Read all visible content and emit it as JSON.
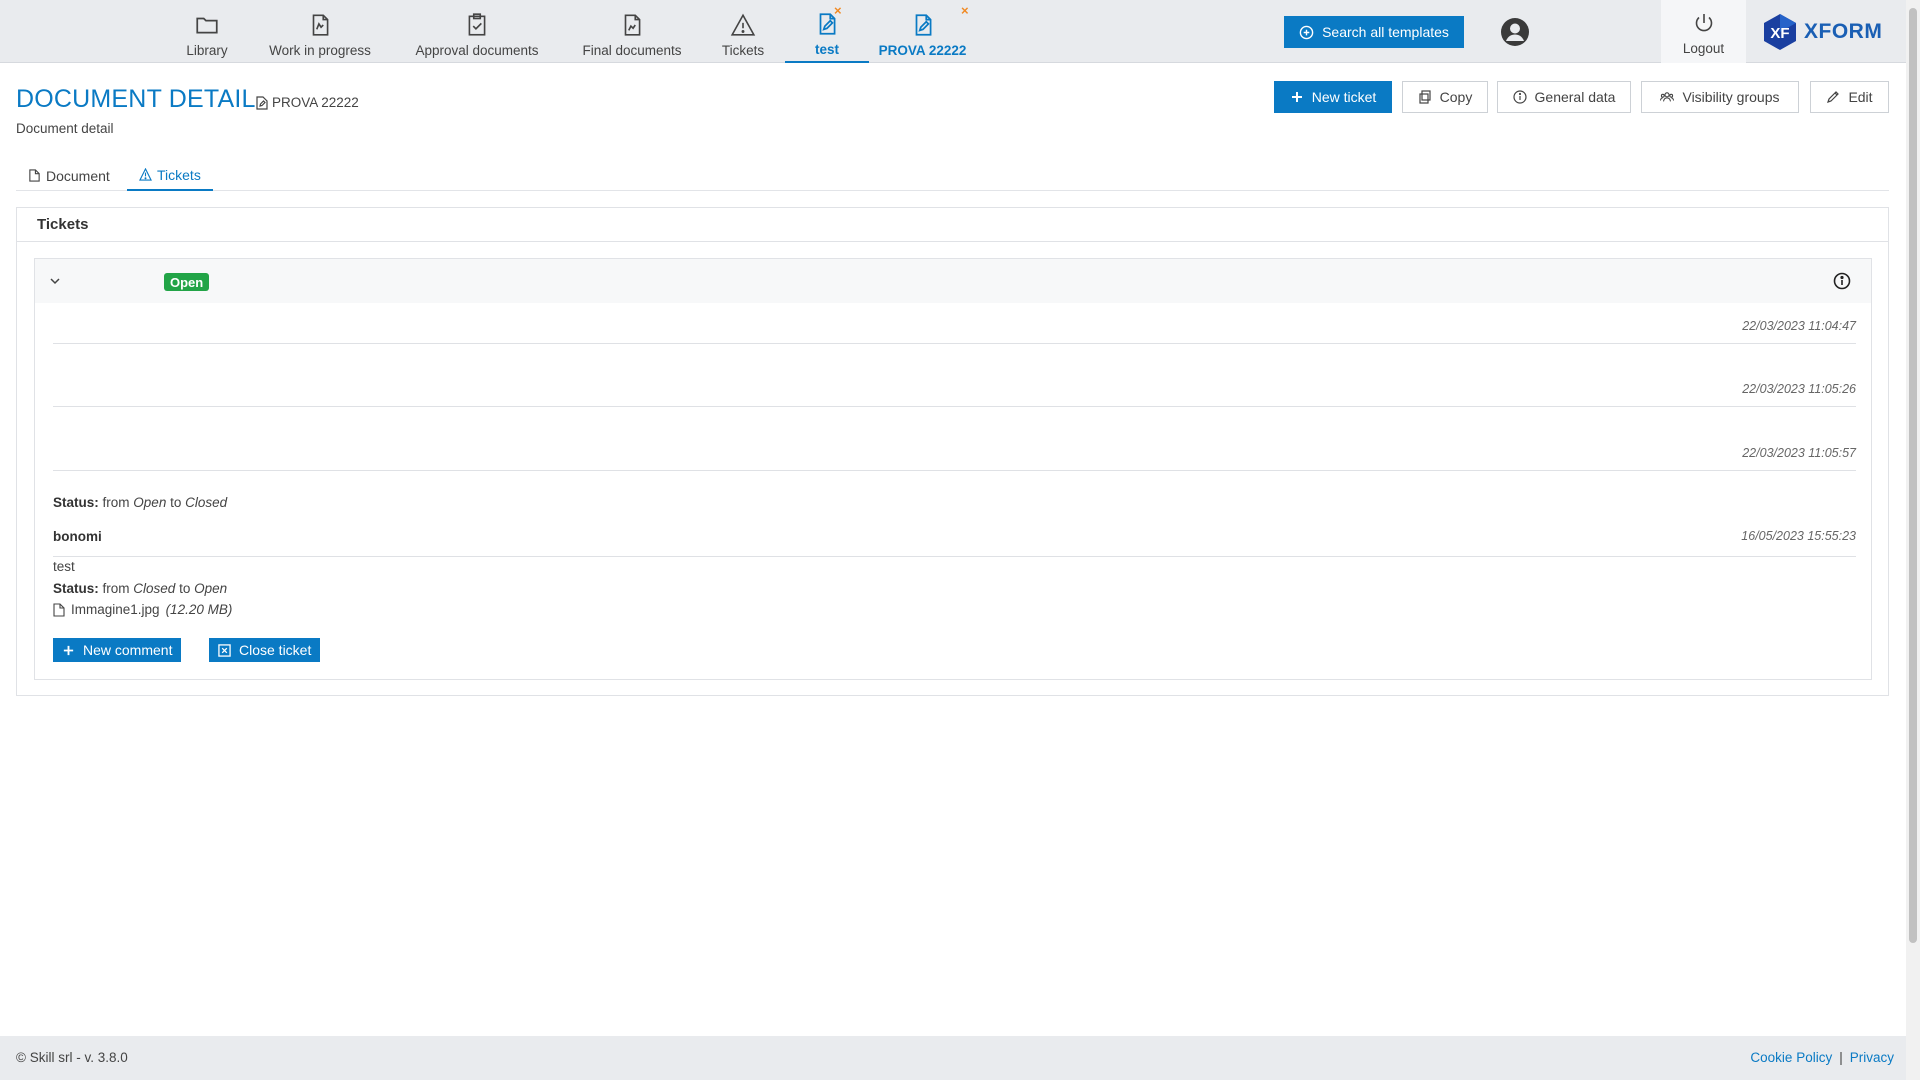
{
  "nav": {
    "items": [
      {
        "label": "Library",
        "icon": "folder-icon"
      },
      {
        "label": "Work in progress",
        "icon": "document-edit-icon"
      },
      {
        "label": "Approval documents",
        "icon": "clipboard-check-icon"
      },
      {
        "label": "Final documents",
        "icon": "document-chart-icon"
      },
      {
        "label": "Tickets",
        "icon": "warning-icon"
      },
      {
        "label": "test",
        "icon": "document-pen-icon",
        "active": true,
        "closable": true
      },
      {
        "label": "PROVA 22222",
        "icon": "document-pen-icon",
        "closable": true
      }
    ],
    "close_glyph": "×"
  },
  "search": {
    "label": "Search all templates"
  },
  "logout": {
    "label": "Logout"
  },
  "logo": {
    "mark": "XF",
    "word": "XFORM"
  },
  "header": {
    "title": "DOCUMENT DETAIL",
    "doc_ref": "PROVA 22222",
    "subtitle": "Document detail"
  },
  "actions": {
    "new_ticket": "New ticket",
    "copy": "Copy",
    "general_data": "General data",
    "visibility_groups": "Visibility groups",
    "edit": "Edit"
  },
  "tabs": [
    {
      "label": "Document"
    },
    {
      "label": "Tickets",
      "active": true
    }
  ],
  "tickets": {
    "title": "Tickets",
    "ticket": {
      "status": "Open",
      "entries": [
        {
          "timestamp": "22/03/2023 11:04:47"
        },
        {
          "timestamp": "22/03/2023 11:05:26"
        },
        {
          "timestamp": "22/03/2023 11:05:57"
        }
      ],
      "status_change_1": {
        "label": "Status:",
        "from_word": "from",
        "from": "Open",
        "to_word": "to",
        "to": "Closed"
      },
      "comment": {
        "author": "bonomi",
        "timestamp": "16/05/2023 15:55:23",
        "text": "test",
        "status_change": {
          "label": "Status:",
          "from_word": "from",
          "from": "Closed",
          "to_word": "to",
          "to": "Open"
        },
        "attachment": {
          "name": "Immagine1.jpg",
          "size": "(12.20 MB)"
        }
      },
      "buttons": {
        "new_comment": "New comment",
        "close_ticket": "Close ticket"
      }
    }
  },
  "footer": {
    "copyright": "© Skill srl - v. 3.8.0",
    "cookie_policy": "Cookie Policy",
    "separator": "|",
    "privacy": "Privacy"
  },
  "colors": {
    "accent": "#0a7ac4",
    "open_badge": "#22a447",
    "close_tab": "#f08a24"
  }
}
